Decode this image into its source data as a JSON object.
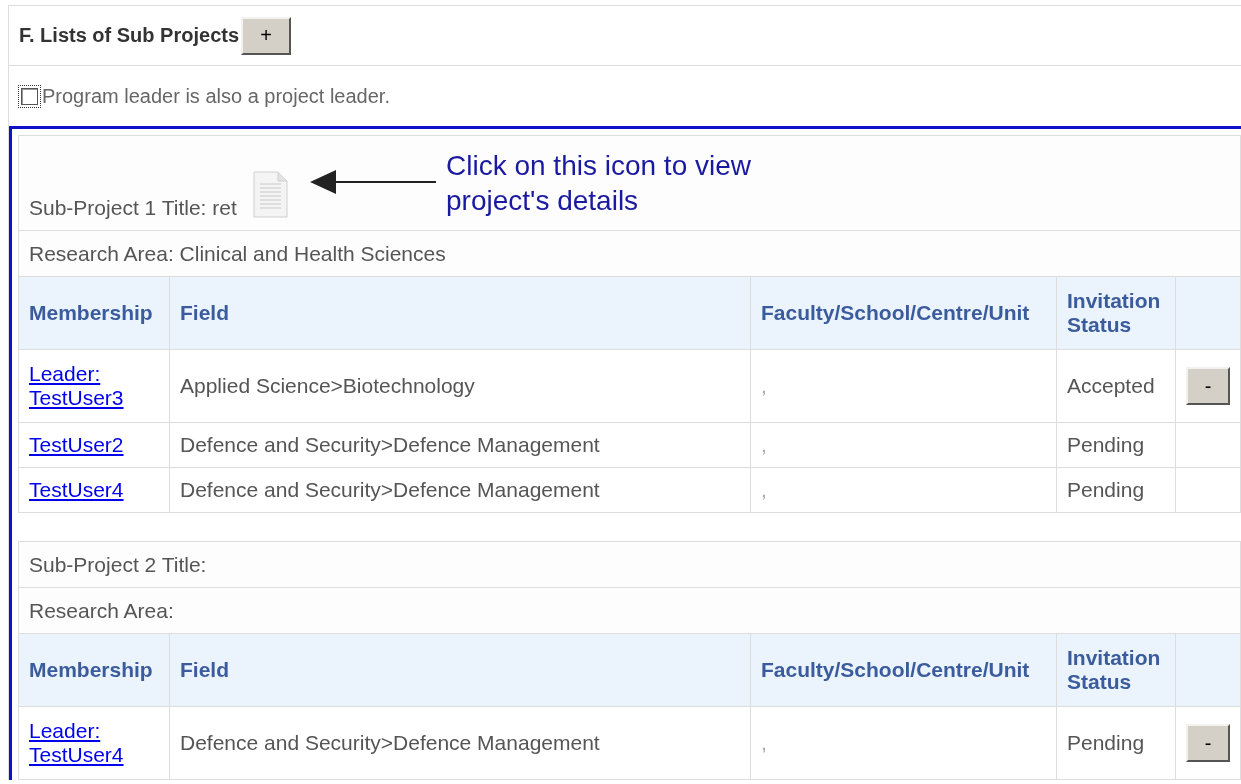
{
  "section": {
    "title": "F. Lists of Sub Projects",
    "add_button": "+"
  },
  "leader_option": {
    "label": "Program leader is also a project leader.",
    "checked": false
  },
  "sub_projects": [
    {
      "title": "Sub-Project 1 Title: ret",
      "details_icon": true,
      "annotation": {
        "lines": [
          "Click on this icon to view",
          "project's details"
        ]
      },
      "research_area": "Research Area: Clinical and Health Sciences",
      "columns": [
        "Membership",
        "Field",
        "Faculty/School/Centre/Unit",
        "Invitation Status"
      ],
      "members": [
        {
          "member": "Leader: TestUser3",
          "field": "Applied Science>Biotechnology",
          "faculty": ",",
          "status": "Accepted",
          "remove_button": "-"
        },
        {
          "member": "TestUser2",
          "field": "Defence and Security>Defence Management",
          "faculty": ",",
          "status": "Pending"
        },
        {
          "member": "TestUser4",
          "field": "Defence and Security>Defence Management",
          "faculty": ",",
          "status": "Pending"
        }
      ]
    },
    {
      "title": "Sub-Project 2 Title:",
      "details_icon": false,
      "research_area": "Research Area:",
      "columns": [
        "Membership",
        "Field",
        "Faculty/School/Centre/Unit",
        "Invitation Status"
      ],
      "members": [
        {
          "member": "Leader: TestUser4",
          "field": "Defence and Security>Defence Management",
          "faculty": ",",
          "status": "Pending",
          "remove_button": "-"
        }
      ]
    }
  ]
}
